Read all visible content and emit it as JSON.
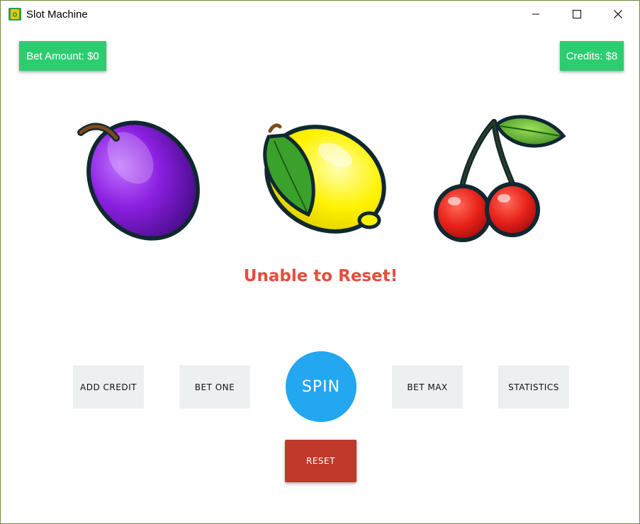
{
  "window": {
    "title": "Slot Machine",
    "controls": {
      "minimize": "minimize-icon",
      "maximize": "maximize-icon",
      "close": "close-icon"
    }
  },
  "header": {
    "bet_amount_label": "Bet Amount: $0",
    "credits_label": "Credits: $8"
  },
  "reels": [
    {
      "symbol": "plum-icon"
    },
    {
      "symbol": "lemon-icon"
    },
    {
      "symbol": "cherry-icon"
    }
  ],
  "status_message": "Unable to Reset!",
  "controls": {
    "add_credit_label": "ADD CREDIT",
    "bet_one_label": "BET ONE",
    "spin_label": "SPIN",
    "bet_max_label": "BET MAX",
    "statistics_label": "STATISTICS",
    "reset_label": "RESET"
  },
  "colors": {
    "accent_green": "#2ecc71",
    "spin_blue": "#22a7f0",
    "reset_red": "#c0392b",
    "status_red": "#e74c3c",
    "button_gray": "#ecf0f1"
  }
}
